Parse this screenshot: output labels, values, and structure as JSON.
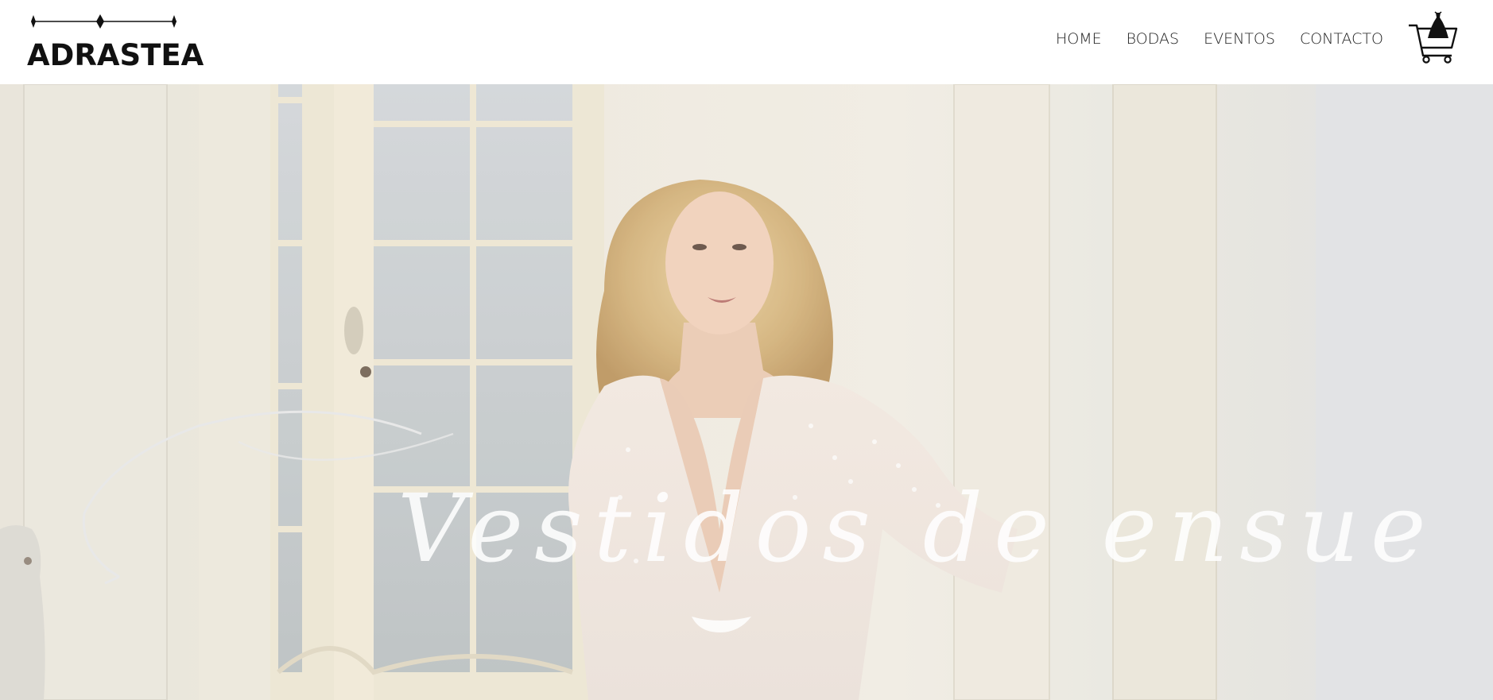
{
  "brand": {
    "name": "ADRASTEA",
    "ornament_icon": "diamond-line-ornament"
  },
  "nav": {
    "items": [
      "HOME",
      "BODAS",
      "EVENTOS",
      "CONTACTO"
    ]
  },
  "cart": {
    "icon": "shopping-cart-dress-icon"
  },
  "hero": {
    "title": "Vestidos de ensueño",
    "image": "bride-in-lace-dress-photo"
  },
  "colors": {
    "text": "#111111",
    "header_bg": "#ffffff",
    "hero_title": "#ffffff"
  }
}
